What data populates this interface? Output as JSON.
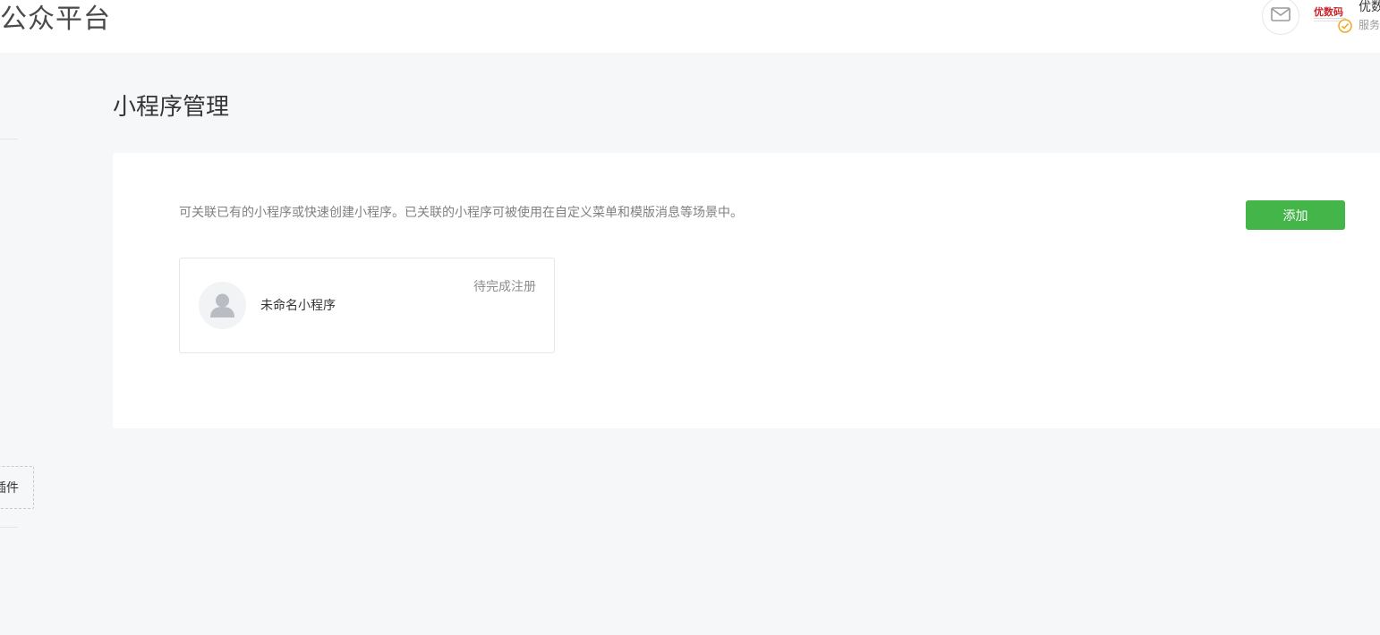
{
  "header": {
    "brand": "公众平台",
    "account_name": "优数",
    "account_type": "服务",
    "account_logo_text": "优数码"
  },
  "sidebar": {
    "plugin_label": "插件"
  },
  "main": {
    "title": "小程序管理",
    "description": "可关联已有的小程序或快速创建小程序。已关联的小程序可被使用在自定义菜单和模版消息等场景中。",
    "add_button_label": "添加",
    "mini_programs": [
      {
        "name": "未命名小程序",
        "status": "待完成注册"
      }
    ]
  },
  "colors": {
    "accent_green": "#44b549",
    "page_background": "#f6f7f9",
    "verified_orange": "#f5a623"
  },
  "icons": {
    "mail": "mail-icon",
    "verified": "verified-check-icon",
    "avatar": "default-avatar-icon"
  }
}
